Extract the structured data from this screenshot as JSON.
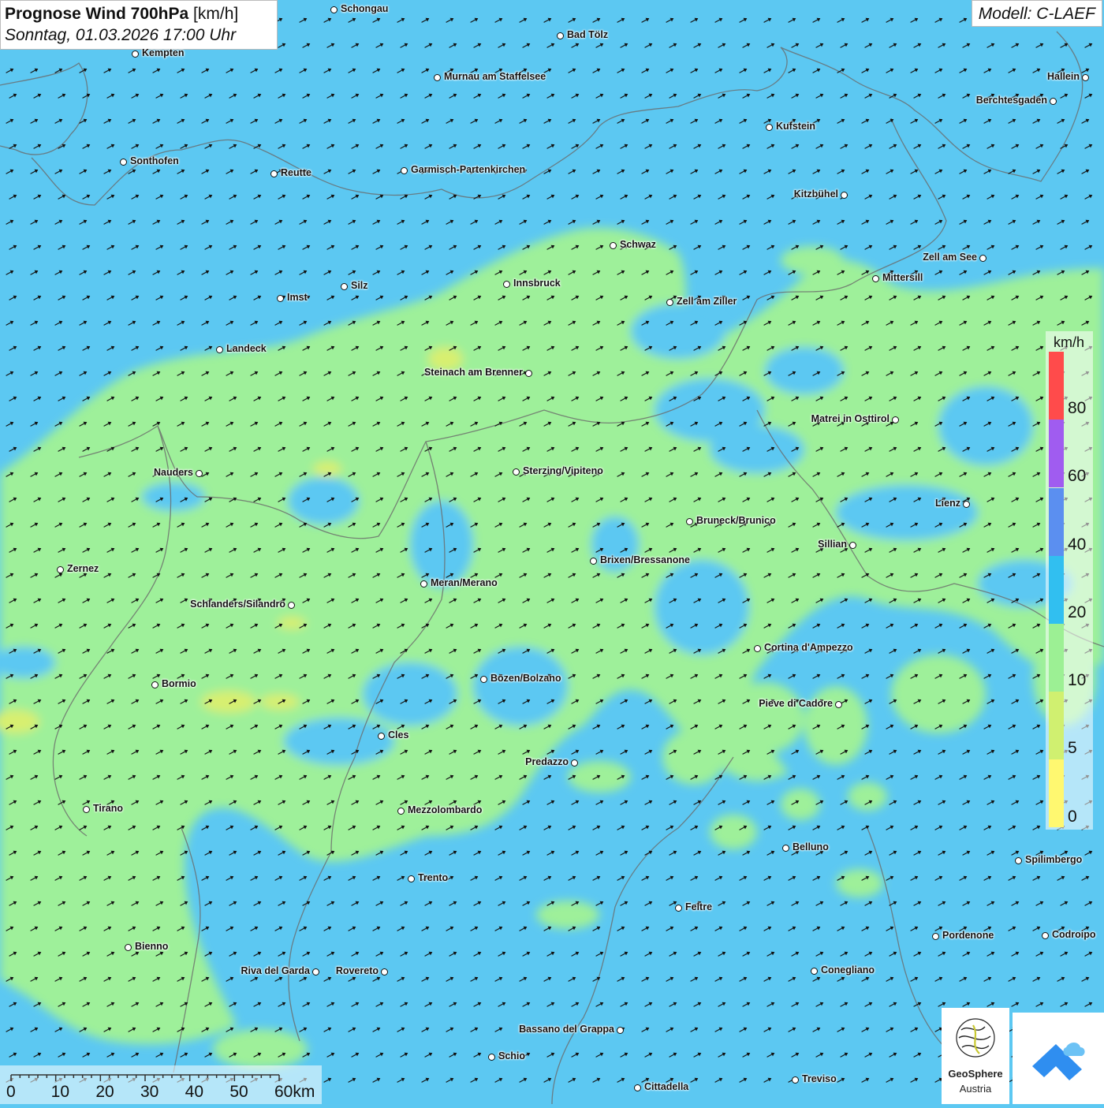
{
  "title": {
    "main_bold": "Prognose Wind 700hPa",
    "main_unit": "[km/h]",
    "subtitle": "Sonntag, 01.03.2026 17:00 Uhr"
  },
  "model_label": "Modell: C-LAEF",
  "legend": {
    "unit": "km/h",
    "ticks": [
      "80",
      "60",
      "40",
      "20",
      "10",
      "5",
      "0"
    ],
    "colors": [
      "#ff4b4b",
      "#a05cf0",
      "#5b8ff0",
      "#31bff0",
      "#9cf094",
      "#d0f070",
      "#fff870"
    ]
  },
  "scale_bar": {
    "labels": [
      "0",
      "10",
      "20",
      "30",
      "40",
      "50",
      "60km"
    ]
  },
  "map_colors": {
    "calm_10_20": "#9ef09a",
    "wind_20_40": "#5cc8f2",
    "wind_5_10": "#d8ef70"
  },
  "wind_direction": "south-west to north-east",
  "cities": [
    {
      "name": "Schongau"
    },
    {
      "name": "Bad Tölz"
    },
    {
      "name": "Kempten"
    },
    {
      "name": "Murnau am Staffelsee"
    },
    {
      "name": "Hallein"
    },
    {
      "name": "Berchtesgaden"
    },
    {
      "name": "Kufstein"
    },
    {
      "name": "Sonthofen"
    },
    {
      "name": "Reutte"
    },
    {
      "name": "Garmisch-Partenkirchen"
    },
    {
      "name": "Kitzbühel"
    },
    {
      "name": "Schwaz"
    },
    {
      "name": "Zell am See"
    },
    {
      "name": "Mittersill"
    },
    {
      "name": "Innsbruck"
    },
    {
      "name": "Silz"
    },
    {
      "name": "Imst"
    },
    {
      "name": "Zell am Ziller"
    },
    {
      "name": "Landeck"
    },
    {
      "name": "Steinach am Brenner"
    },
    {
      "name": "Matrei in Osttirol"
    },
    {
      "name": "Nauders"
    },
    {
      "name": "Sterzing/Vipiteno"
    },
    {
      "name": "Lienz"
    },
    {
      "name": "Bruneck/Brunico"
    },
    {
      "name": "Sillian"
    },
    {
      "name": "Zernez"
    },
    {
      "name": "Brixen/Bressanone"
    },
    {
      "name": "Meran/Merano"
    },
    {
      "name": "Schlanders/Silandro"
    },
    {
      "name": "Cortina d'Ampezzo"
    },
    {
      "name": "Bozen/Bolzano"
    },
    {
      "name": "Bormio"
    },
    {
      "name": "Pieve di Cadore"
    },
    {
      "name": "Cles"
    },
    {
      "name": "Predazzo"
    },
    {
      "name": "Tirano"
    },
    {
      "name": "Mezzolombardo"
    },
    {
      "name": "Belluno"
    },
    {
      "name": "Spilimbergo"
    },
    {
      "name": "Trento"
    },
    {
      "name": "Feltre"
    },
    {
      "name": "Pordenone"
    },
    {
      "name": "Codroipo"
    },
    {
      "name": "Bienno"
    },
    {
      "name": "Riva del Garda"
    },
    {
      "name": "Rovereto"
    },
    {
      "name": "Conegliano"
    },
    {
      "name": "Bassano del Grappa"
    },
    {
      "name": "Schio"
    },
    {
      "name": "Treviso"
    },
    {
      "name": "Cittadella"
    }
  ],
  "logos": {
    "geosphere_line1": "GeoSphere",
    "geosphere_line2": "Austria"
  }
}
